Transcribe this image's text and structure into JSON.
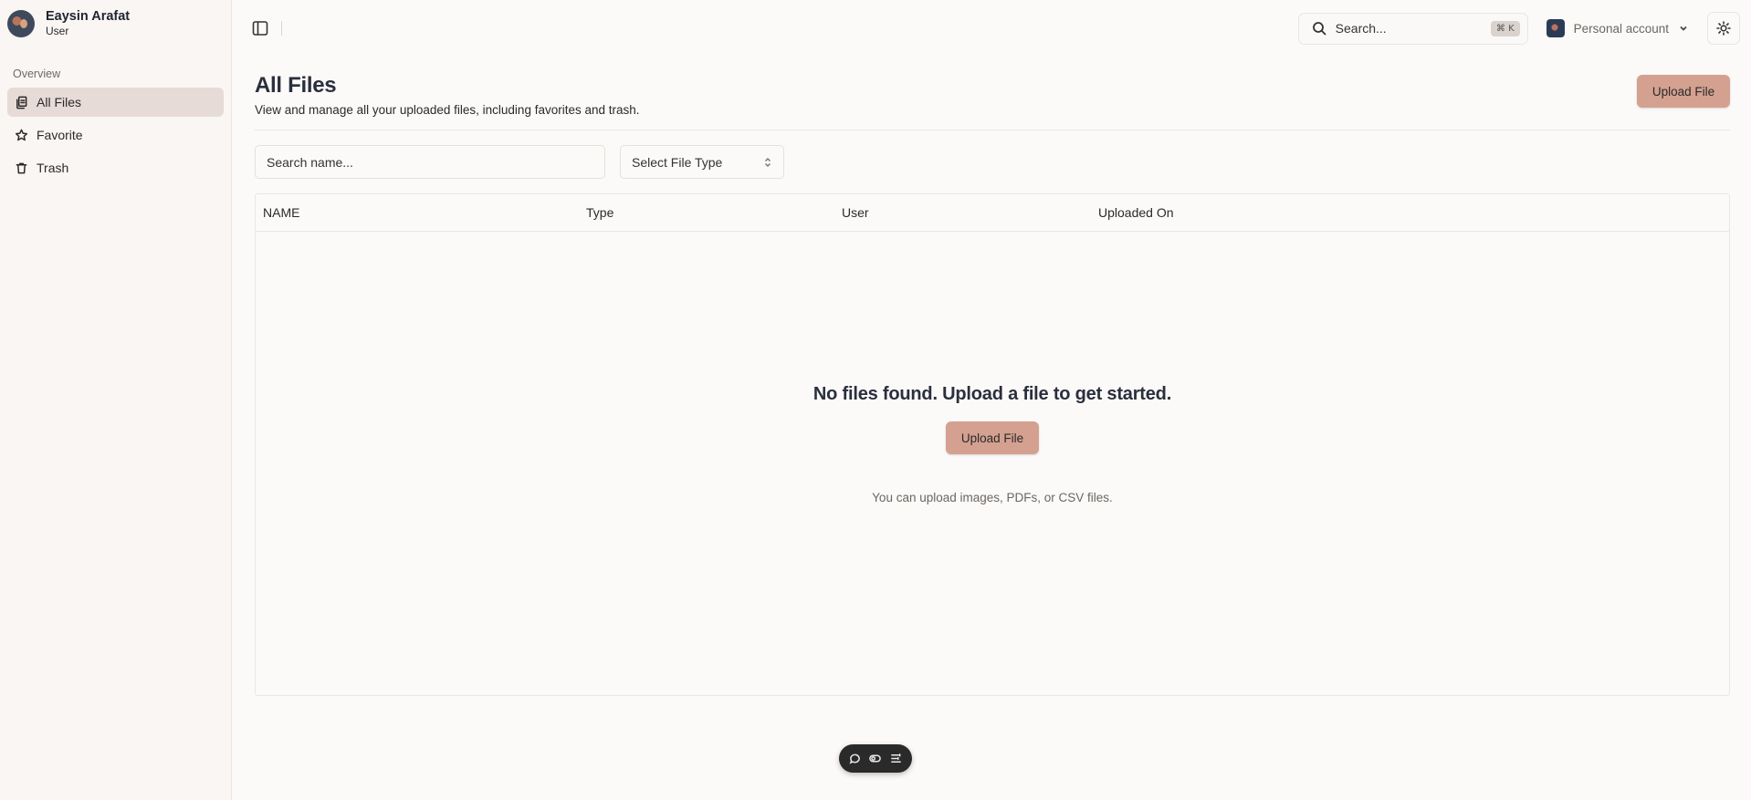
{
  "user": {
    "name": "Eaysin Arafat",
    "role": "User"
  },
  "sidebar": {
    "section": "Overview",
    "items": [
      {
        "label": "All Files",
        "icon": "files-icon",
        "active": true
      },
      {
        "label": "Favorite",
        "icon": "star-icon",
        "active": false
      },
      {
        "label": "Trash",
        "icon": "trash-icon",
        "active": false
      }
    ]
  },
  "topbar": {
    "search_placeholder": "Search...",
    "search_shortcut": "⌘ K",
    "account_label": "Personal account"
  },
  "page": {
    "title": "All Files",
    "subtitle": "View and manage all your uploaded files, including favorites and trash.",
    "upload_label": "Upload File"
  },
  "filters": {
    "name_placeholder": "Search name...",
    "file_type_label": "Select File Type"
  },
  "table": {
    "columns": [
      "NAME",
      "Type",
      "User",
      "Uploaded On"
    ],
    "rows": []
  },
  "empty_state": {
    "title": "No files found. Upload a file to get started.",
    "button_label": "Upload File",
    "hint": "You can upload images, PDFs, or CSV files."
  },
  "colors": {
    "accent": "#d4a190",
    "active_nav": "#e6dbd6",
    "background": "#fcfaf8"
  }
}
